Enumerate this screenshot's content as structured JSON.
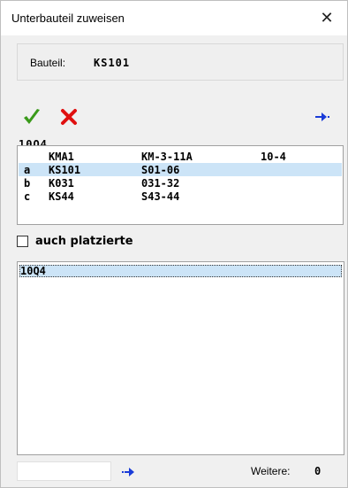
{
  "window": {
    "title": "Unterbauteil zuweisen",
    "close_glyph": "✕"
  },
  "bauteil": {
    "label": "Bauteil:",
    "value": "KS101"
  },
  "toolbar": {
    "ok_icon": "checkmark-icon",
    "cancel_icon": "cross-icon",
    "next_icon": "arrow-right-icon",
    "ok_color": "#3a9a1a",
    "cancel_color": "#e01010",
    "arrow_color": "#1a3cd8"
  },
  "code_label": "10Q4",
  "list": {
    "rows": [
      {
        "key": "",
        "col1": "KMA1",
        "col2": "KM-3-11A",
        "col3": "10-4",
        "selected": false
      },
      {
        "key": "a",
        "col1": "KS101",
        "col2": "S01-06",
        "col3": "",
        "selected": true
      },
      {
        "key": "b",
        "col1": "K031",
        "col2": "031-32",
        "col3": "",
        "selected": false
      },
      {
        "key": "c",
        "col1": "KS44",
        "col2": "S43-44",
        "col3": "",
        "selected": false
      }
    ],
    "selection_color": "#cce4f7"
  },
  "checkbox": {
    "label": "auch platzierte",
    "checked": false
  },
  "list2": {
    "items": [
      "10Q4"
    ]
  },
  "footer": {
    "input_value": "",
    "weitere_label": "Weitere:",
    "weitere_value": "0"
  }
}
